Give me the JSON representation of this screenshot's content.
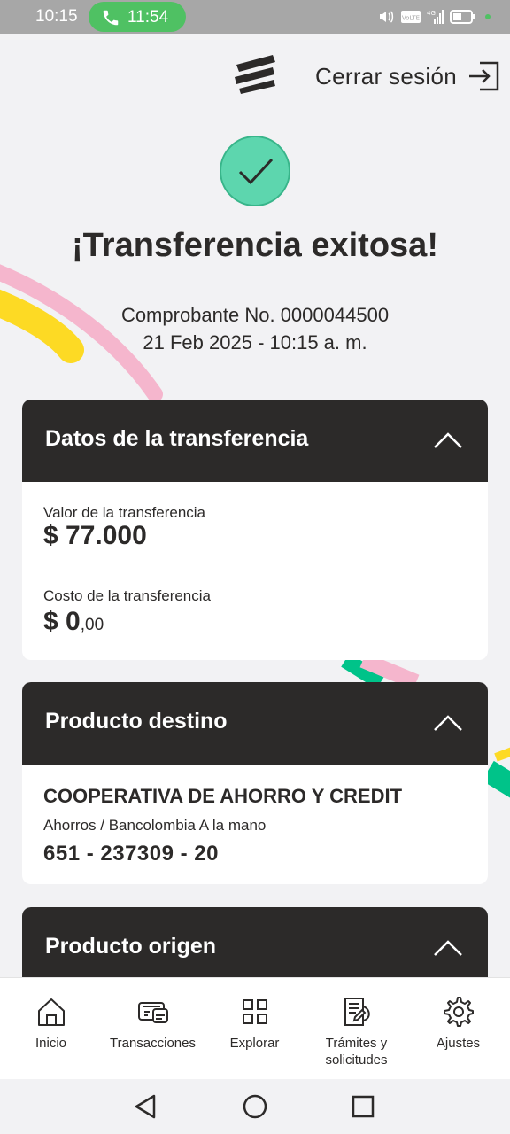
{
  "status_bar": {
    "time": "10:15",
    "call_time": "11:54"
  },
  "header": {
    "logout_label": "Cerrar sesión"
  },
  "result": {
    "title": "¡Transferencia exitosa!",
    "receipt": "Comprobante No. 0000044500",
    "datetime": "21 Feb 2025 - 10:15 a. m."
  },
  "transfer_card": {
    "title": "Datos de la transferencia",
    "value_label": "Valor de la transferencia",
    "value": "$ 77.000",
    "cost_label": "Costo de la transferencia",
    "cost_main": "$ 0",
    "cost_decimals": ",00"
  },
  "destination_card": {
    "title": "Producto destino",
    "name": "COOPERATIVA DE AHORRO Y CREDIT",
    "type": "Ahorros / Bancolombia A la mano",
    "account": "651 - 237309 - 20"
  },
  "origin_card": {
    "title": "Producto origen"
  },
  "bottom_nav": {
    "items": [
      {
        "label": "Inicio",
        "icon": "home-icon"
      },
      {
        "label": "Transacciones",
        "icon": "cards-icon"
      },
      {
        "label": "Explorar",
        "icon": "grid-icon"
      },
      {
        "label": "Trámites y solicitudes",
        "icon": "document-icon"
      },
      {
        "label": "Ajustes",
        "icon": "gear-icon"
      }
    ]
  },
  "colors": {
    "dark": "#2c2a29",
    "success": "#5dd6ae",
    "accent_yellow": "#fdda24",
    "accent_pink": "#f5b6cd",
    "accent_green": "#00c389"
  }
}
